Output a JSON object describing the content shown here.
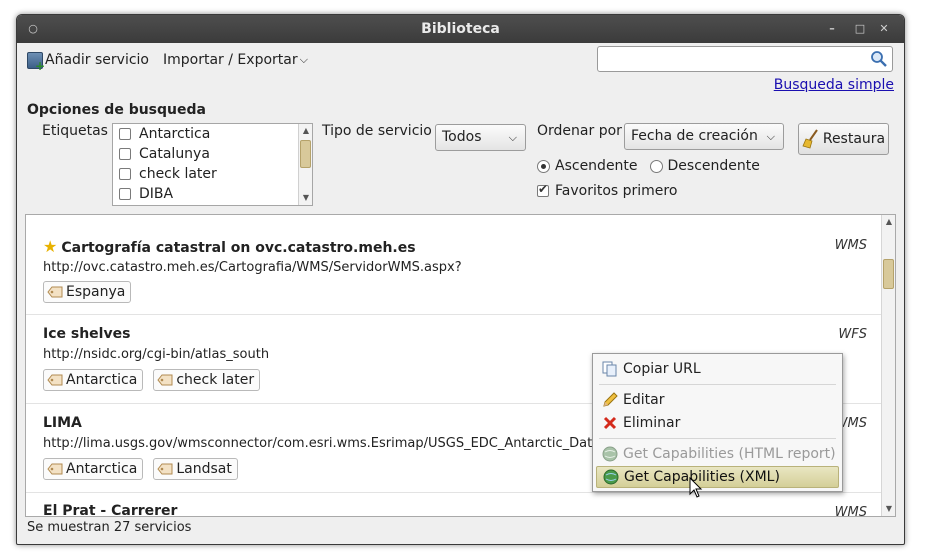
{
  "window": {
    "title": "Biblioteca"
  },
  "toolbar": {
    "add_label": "Añadir servicio",
    "import_export_label": "Importar / Exportar"
  },
  "search": {
    "value": "",
    "placeholder": "",
    "simple_link": "Busqueda simple"
  },
  "options": {
    "title": "Opciones de busqueda",
    "tags_label": "Etiquetas",
    "tags": [
      "Antarctica",
      "Catalunya",
      "check later",
      "DIBA"
    ],
    "type_label": "Tipo de servicio",
    "type_value": "Todos",
    "order_label": "Ordenar por",
    "order_value": "Fecha de creación",
    "asc_label": "Ascendente",
    "desc_label": "Descendente",
    "fav_label": "Favoritos primero",
    "reset_label": "Restaura"
  },
  "services": [
    {
      "title": "Cartografía catastral on ovc.catastro.meh.es",
      "type": "WMS",
      "url": "http://ovc.catastro.meh.es/Cartografia/WMS/ServidorWMS.aspx?",
      "tags": [
        "Espanya"
      ]
    },
    {
      "title": "Ice shelves",
      "type": "WFS",
      "url": "http://nsidc.org/cgi-bin/atlas_south",
      "tags": [
        "Antarctica",
        "check later"
      ]
    },
    {
      "title": "LIMA",
      "type": "WMS",
      "url": "http://lima.usgs.gov/wmsconnector/com.esri.wms.Esrimap/USGS_EDC_Antarctic_Dat",
      "tags": [
        "Antarctica",
        "Landsat"
      ]
    },
    {
      "title": "El Prat - Carrerer",
      "type": "WMS",
      "url": "",
      "tags": []
    }
  ],
  "status": {
    "text": "Se muestran 27 servicios"
  },
  "context_menu": {
    "copy_url": "Copiar URL",
    "edit": "Editar",
    "delete": "Eliminar",
    "caps_html": "Get Capabilities (HTML report)",
    "caps_xml": "Get Capabilities (XML)"
  }
}
